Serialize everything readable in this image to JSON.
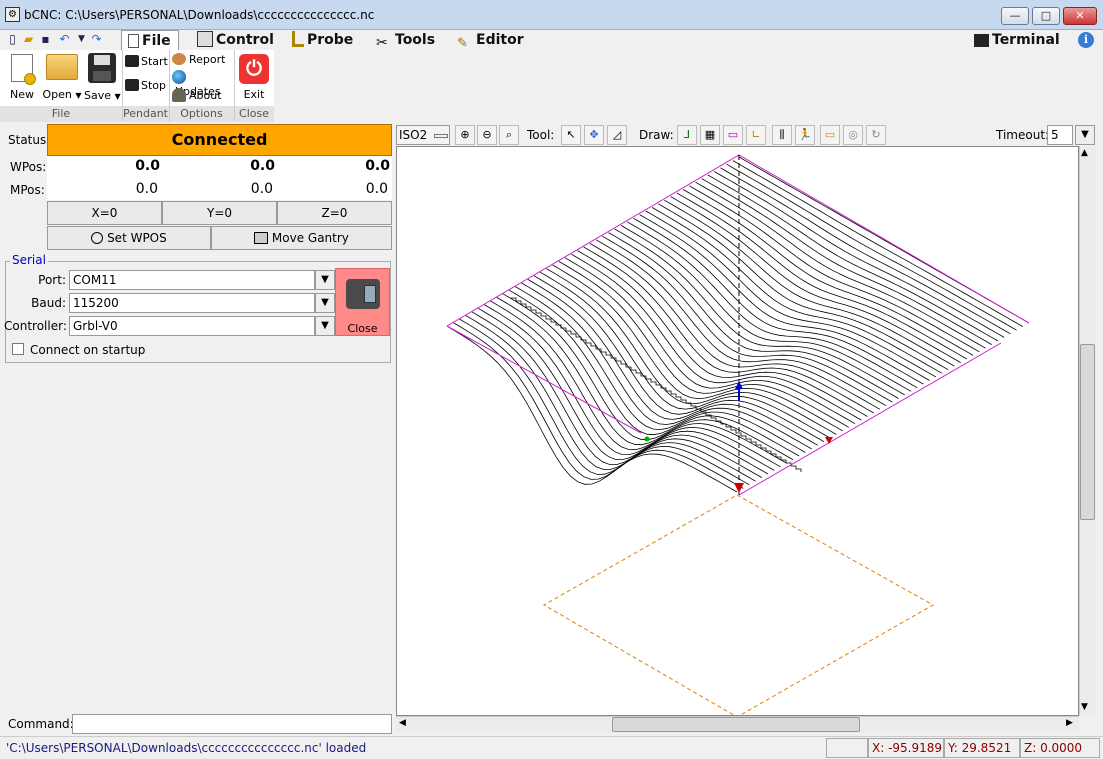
{
  "window": {
    "title": "bCNC: C:\\Users\\PERSONAL\\Downloads\\ccccccccccccccc.nc"
  },
  "tabs": [
    "File",
    "Control",
    "Probe",
    "Tools",
    "Editor"
  ],
  "terminal_tab": "Terminal",
  "ribbon": {
    "file": {
      "new": "New",
      "open": "Open",
      "save": "Save",
      "group": "File"
    },
    "pendant": {
      "start": "Start",
      "stop": "Stop",
      "group": "Pendant"
    },
    "options": {
      "report": "Report",
      "updates": "Updates",
      "about": "About",
      "group": "Options"
    },
    "close": {
      "exit": "Exit",
      "group": "Close"
    }
  },
  "status": {
    "label": "Status:",
    "value": "Connected",
    "color": "#ffa500"
  },
  "position": {
    "wpos_label": "WPos:",
    "mpos_label": "MPos:",
    "wpos": [
      "0.0",
      "0.0",
      "0.0"
    ],
    "mpos": [
      "0.0",
      "0.0",
      "0.0"
    ],
    "zero_buttons": [
      "X=0",
      "Y=0",
      "Z=0"
    ],
    "set_wpos": "Set WPOS",
    "move_gantry": "Move Gantry"
  },
  "serial": {
    "title": "Serial",
    "port_label": "Port:",
    "port": "COM11",
    "baud_label": "Baud:",
    "baud": "115200",
    "controller_label": "Controller:",
    "controller": "Grbl-V0",
    "close_label": "Close",
    "connect_on_startup": "Connect on startup"
  },
  "canvas_toolbar": {
    "view": "ISO2",
    "tool_label": "Tool:",
    "draw_label": "Draw:",
    "timeout_label": "Timeout:",
    "timeout": "5"
  },
  "command": {
    "label": "Command:",
    "value": ""
  },
  "statusbar": {
    "message": "'C:\\Users\\PERSONAL\\Downloads\\ccccccccccccccc.nc' loaded",
    "x": "X: -95.9189",
    "y": "Y: 29.8521",
    "z": "Z: 0.0000"
  }
}
